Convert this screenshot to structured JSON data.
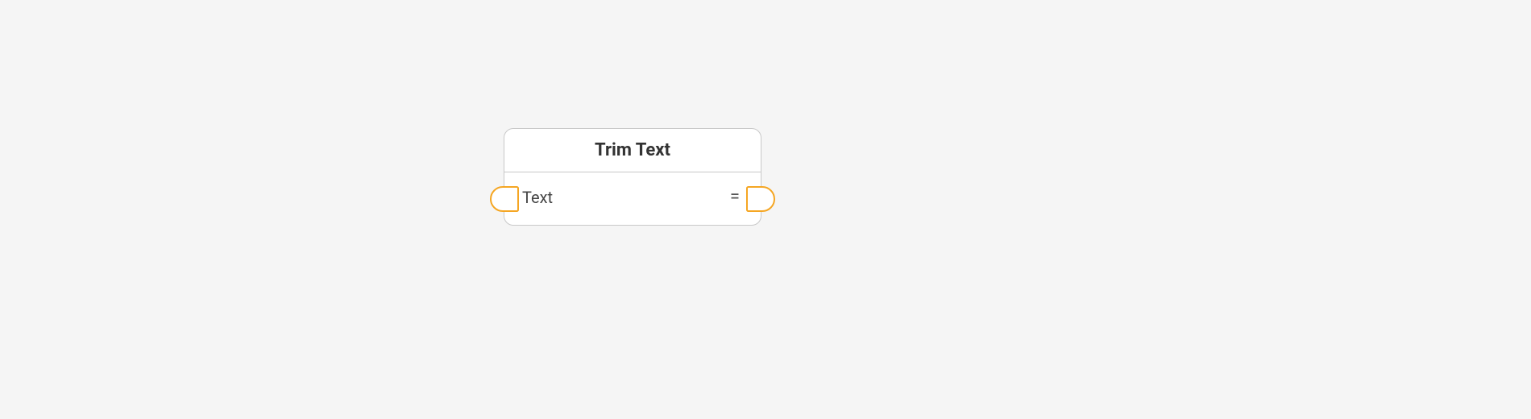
{
  "node": {
    "title": "Trim Text",
    "input_label": "Text",
    "output_label": "="
  },
  "colors": {
    "port_border": "#f5a623",
    "node_border": "#c8c8c8",
    "background": "#f5f5f5"
  }
}
